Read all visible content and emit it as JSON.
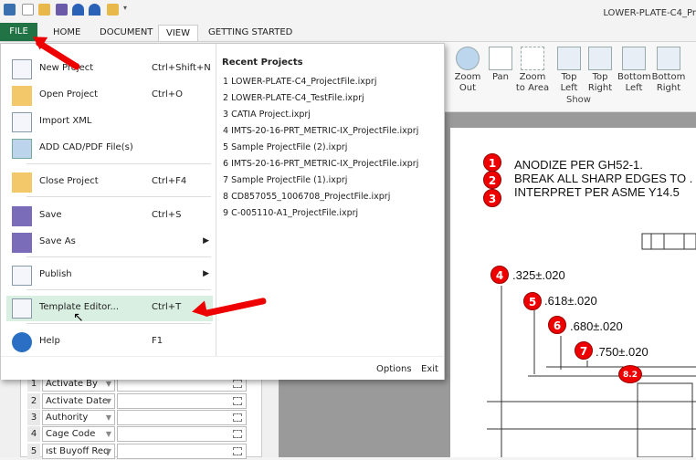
{
  "window": {
    "title": "LOWER-PLATE-C4_Pr"
  },
  "tabs": [
    "FILE",
    "HOME",
    "DOCUMENT",
    "VIEW",
    "GETTING STARTED"
  ],
  "ribbon": {
    "buttons": [
      {
        "label": "Zoom Out",
        "icon": "zoom-out-icon"
      },
      {
        "label": "Pan",
        "icon": "hand-icon"
      },
      {
        "label": "Zoom to Area",
        "icon": "zoom-area-icon"
      },
      {
        "label": "Top Left",
        "icon": "page-top-left-icon"
      },
      {
        "label": "Top Right",
        "icon": "page-top-right-icon"
      },
      {
        "label": "Bottom Left",
        "icon": "page-bottom-left-icon"
      },
      {
        "label": "Bottom Right",
        "icon": "page-bottom-right-icon"
      }
    ],
    "group_label": "Show"
  },
  "file_menu": {
    "items": [
      {
        "label": "New Project",
        "shortcut": "Ctrl+Shift+N",
        "icon": "new-document-icon"
      },
      {
        "label": "Open Project",
        "shortcut": "Ctrl+O",
        "icon": "open-folder-icon"
      },
      {
        "label": "Import XML",
        "shortcut": "",
        "icon": "import-icon"
      },
      {
        "label": "ADD CAD/PDF File(s)",
        "shortcut": "",
        "icon": "add-image-icon"
      },
      {
        "label": "Close Project",
        "shortcut": "Ctrl+F4",
        "icon": "close-folder-icon"
      },
      {
        "label": "Save",
        "shortcut": "Ctrl+S",
        "icon": "save-icon"
      },
      {
        "label": "Save As",
        "shortcut": "",
        "icon": "save-as-icon"
      },
      {
        "label": "Publish",
        "shortcut": "",
        "icon": "publish-icon"
      },
      {
        "label": "Template Editor...",
        "shortcut": "Ctrl+T",
        "icon": "template-icon"
      },
      {
        "label": "Help",
        "shortcut": "F1",
        "icon": "help-icon"
      }
    ],
    "recent_title": "Recent Projects",
    "recent": [
      "1 LOWER-PLATE-C4_ProjectFile.ixprj",
      "2 LOWER-PLATE-C4_TestFile.ixprj",
      "3 CATIA Project.ixprj",
      "4 IMTS-20-16-PRT_METRIC-IX_ProjectFile.ixprj",
      "5 Sample ProjectFile (2).ixprj",
      "6 IMTS-20-16-PRT_METRIC-IX_ProjectFile.ixprj",
      "7 Sample ProjectFile (1).ixprj",
      "8 CD857055_1006708_ProjectFile.ixprj",
      "9 C-005110-A1_ProjectFile.ixprj"
    ],
    "options": "Options",
    "exit": "Exit"
  },
  "grid": [
    {
      "n": "1",
      "field": "Activate By"
    },
    {
      "n": "2",
      "field": "Activate Date"
    },
    {
      "n": "3",
      "field": "Authority"
    },
    {
      "n": "4",
      "field": "Cage Code"
    },
    {
      "n": "5",
      "field": "ıst Buyoff Req"
    }
  ],
  "drawing": {
    "notes": [
      {
        "n": "1",
        "text": "ANODIZE PER GH52-1."
      },
      {
        "n": "2",
        "text": "BREAK ALL SHARP EDGES TO ."
      },
      {
        "n": "3",
        "text": "INTERPRET PER ASME Y14.5"
      }
    ],
    "dims": [
      {
        "n": "4",
        "text": ".325±.020"
      },
      {
        "n": "5",
        "text": ".618±.020"
      },
      {
        "n": "6",
        "text": ".680±.020"
      },
      {
        "n": "7",
        "text": ".750±.020"
      },
      {
        "n": "8.2",
        "text": ""
      }
    ]
  },
  "colors": {
    "file_tab": "#217346",
    "highlight": "#d9efe1",
    "balloon": "#e00000"
  }
}
